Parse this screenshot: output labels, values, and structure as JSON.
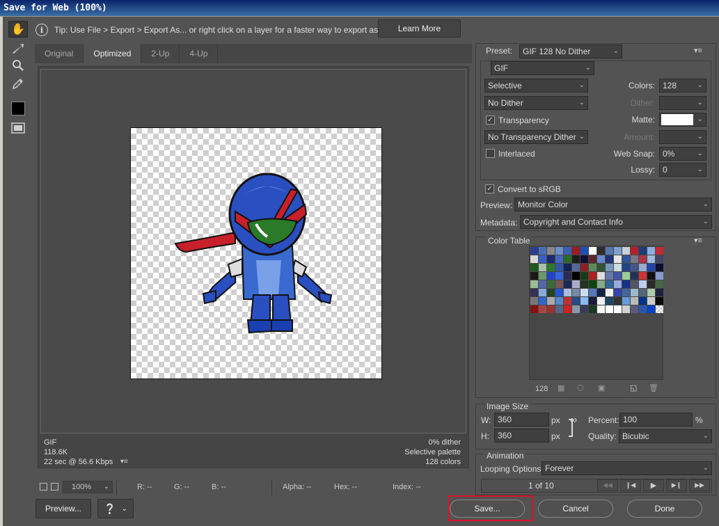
{
  "window": {
    "title": "Save for Web (100%)"
  },
  "tip": {
    "text": "Tip: Use File > Export > Export As...  or right click on a layer for a faster way to export assets",
    "learn_more": "Learn More"
  },
  "tabs": [
    {
      "label": "Original"
    },
    {
      "label": "Optimized"
    },
    {
      "label": "2-Up"
    },
    {
      "label": "4-Up"
    }
  ],
  "preview_info": {
    "format": "GIF",
    "size": "118.6K",
    "time": "22 sec @ 56.6 Kbps",
    "dither": "0% dither",
    "palette": "Selective palette",
    "colors": "128 colors"
  },
  "status": {
    "zoom": "100%",
    "r": "R: --",
    "g": "G: --",
    "b": "B: --",
    "alpha": "Alpha: --",
    "hex": "Hex: --",
    "index": "Index: --"
  },
  "buttons": {
    "preview": "Preview...",
    "save": "Save...",
    "cancel": "Cancel",
    "done": "Done"
  },
  "settings": {
    "preset_label": "Preset:",
    "preset_value": "GIF 128 No Dither",
    "format": "GIF",
    "reduction": "Selective",
    "dither_algo": "No Dither",
    "transparency_label": "Transparency",
    "transparency_checked": true,
    "transparency_dither": "No Transparency Dither",
    "interlaced_label": "Interlaced",
    "interlaced_checked": false,
    "colors_label": "Colors:",
    "colors_value": "128",
    "dither_label": "Dither:",
    "matte_label": "Matte:",
    "amount_label": "Amount:",
    "websnap_label": "Web Snap:",
    "websnap_value": "0%",
    "lossy_label": "Lossy:",
    "lossy_value": "0",
    "convert_label": "Convert to sRGB",
    "convert_checked": true,
    "preview_label": "Preview:",
    "preview_value": "Monitor Color",
    "metadata_label": "Metadata:",
    "metadata_value": "Copyright and Contact Info"
  },
  "color_table": {
    "title": "Color Table",
    "count": "128",
    "swatches": [
      "#2b3f8f",
      "#4a6fb5",
      "#888888",
      "#6b8fc9",
      "#3d5fb0",
      "#9a1c25",
      "#1e4fb3",
      "#ffffff",
      "#2c2c2c",
      "#5577aa",
      "#7ea0d0",
      "#c9cfd9",
      "#b2202c",
      "#1f3b7a",
      "#8ab0e0",
      "#c42832",
      "#d8d8d8",
      "#3a5fc0",
      "#1a2a6a",
      "#4466bb",
      "#2a6a2a",
      "#1c1c1c",
      "#101030",
      "#5a2a2a",
      "#6688cc",
      "#223377",
      "#e6e6e6",
      "#335599",
      "#777788",
      "#aa3344",
      "#99bbdd",
      "#444466",
      "#1e5a1e",
      "#a8c0a8",
      "#2d7a2d",
      "#3355aa",
      "#112255",
      "#556699",
      "#882222",
      "#5b8b5b",
      "#335533",
      "#7799bb",
      "#ccdde0",
      "#224488",
      "#445588",
      "#99aacc",
      "#2244aa",
      "#0f0f2f",
      "#1a1a1a",
      "#6a9a6a",
      "#2244cc",
      "#3366dd",
      "#2a2a55",
      "#000000",
      "#1a3a1a",
      "#aa2222",
      "#dddddd",
      "#6677aa",
      "#4455aa",
      "#99cc99",
      "#223355",
      "#cc3333",
      "#111111",
      "#8899cc",
      "#99bb99",
      "#5566aa",
      "#3a6a3a",
      "#775555",
      "#1a2a55",
      "#aaaacc",
      "#223322",
      "#114411",
      "#88aa88",
      "#336699",
      "#99aadd",
      "#113388",
      "#555566",
      "#bbccee",
      "#2a2a2a",
      "#446644",
      "#333355",
      "#88aadd",
      "#224422",
      "#2255cc",
      "#aabbdd",
      "#7788aa",
      "#ccddee",
      "#5577bb",
      "#112244",
      "#eeeeee",
      "#3344aa",
      "#446699",
      "#99bbcc",
      "#556677",
      "#aaccaa",
      "#202040",
      "#777777",
      "#3366cc",
      "#aaaaaa",
      "#5588cc",
      "#bb3333",
      "#2a4a8a",
      "#88bbee",
      "#1a1a3a",
      "#f0f0f0",
      "#224466",
      "#333333",
      "#6699dd",
      "#bbbbbb",
      "#003388",
      "#cccccc",
      "#0a0a0a",
      "#881111",
      "#aa4444",
      "#993333",
      "#556688",
      "#cc2222",
      "#8899aa",
      "#3a3a5a",
      "#1a3a22",
      "#f8f8f8",
      "#ffffff",
      "#fefefe",
      "#d0d0d0",
      "#5a5a7a",
      "#2a55aa",
      "#0044cc",
      "transparent"
    ]
  },
  "image_size": {
    "title": "Image Size",
    "w_label": "W:",
    "w_value": "360",
    "h_label": "H:",
    "h_value": "360",
    "unit": "px",
    "percent_label": "Percent:",
    "percent_value": "100",
    "percent_unit": "%",
    "quality_label": "Quality:",
    "quality_value": "Bicubic"
  },
  "animation": {
    "title": "Animation",
    "looping_label": "Looping Options:",
    "looping_value": "Forever",
    "frame": "1 of 10"
  }
}
